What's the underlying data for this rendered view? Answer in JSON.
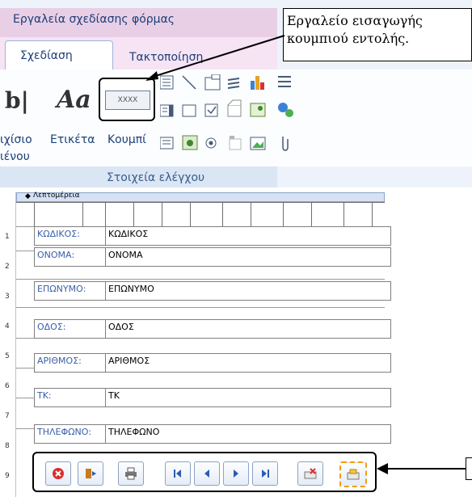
{
  "ribbon": {
    "context_title": "Εργαλεία σχεδίασης φόρμας",
    "tabs": [
      {
        "label": "Σχεδίαση",
        "selected": true
      },
      {
        "label": "Τακτοποίηση",
        "selected": false
      }
    ],
    "group_label": "Στοιχεία ελέγχου",
    "labels": {
      "textbox_partial": "ιχίσιο",
      "textbox_partial2": "ιένου",
      "label": "Ετικέτα",
      "button": "Κουμπί",
      "button_sample": "XXXX",
      "b_glyph": "b|",
      "aa_glyph": "Aa"
    }
  },
  "callout": {
    "text": "Εργαλείο εισαγωγής κουμπιού εντολής."
  },
  "form": {
    "section_title": "Λεπτομέρεια",
    "ruler": [
      "1",
      "2",
      "3",
      "4",
      "5",
      "6",
      "7",
      "8",
      "9"
    ],
    "fields": [
      {
        "label": "ΚΩΔΙΚΟΣ:",
        "value": "ΚΩΔΙΚΟΣ"
      },
      {
        "label": "ΟΝΟΜΑ:",
        "value": "ΟΝΟΜΑ"
      },
      {
        "label": "ΕΠΩΝΥΜΟ:",
        "value": "ΕΠΩΝΥΜΟ"
      },
      {
        "label": "ΟΔΟΣ:",
        "value": "ΟΔΟΣ"
      },
      {
        "label": "ΑΡΙΘΜΟΣ:",
        "value": "ΑΡΙΘΜΟΣ"
      },
      {
        "label": "ΤΚ:",
        "value": "ΤΚ"
      },
      {
        "label": "ΤΗΛΕΦΩΝΟ:",
        "value": "ΤΗΛΕΦΩΝΟ"
      }
    ]
  },
  "nav_buttons": [
    {
      "name": "close-form-button",
      "icon": "close-icon",
      "color": "#d9302c"
    },
    {
      "name": "exit-button",
      "icon": "exit-door-icon",
      "color": "#c97a1a"
    },
    {
      "name": "print-button",
      "icon": "printer-icon",
      "color": "#555555"
    },
    {
      "name": "first-record-button",
      "icon": "first-record-icon",
      "color": "#2a5db0"
    },
    {
      "name": "previous-record-button",
      "icon": "previous-record-icon",
      "color": "#2a5db0"
    },
    {
      "name": "next-record-button",
      "icon": "next-record-icon",
      "color": "#2a5db0"
    },
    {
      "name": "last-record-button",
      "icon": "last-record-icon",
      "color": "#2a5db0"
    },
    {
      "name": "delete-record-button",
      "icon": "delete-record-icon",
      "color": "#d9302c"
    },
    {
      "name": "new-record-button",
      "icon": "new-record-icon",
      "color": "#2a5db0"
    }
  ]
}
